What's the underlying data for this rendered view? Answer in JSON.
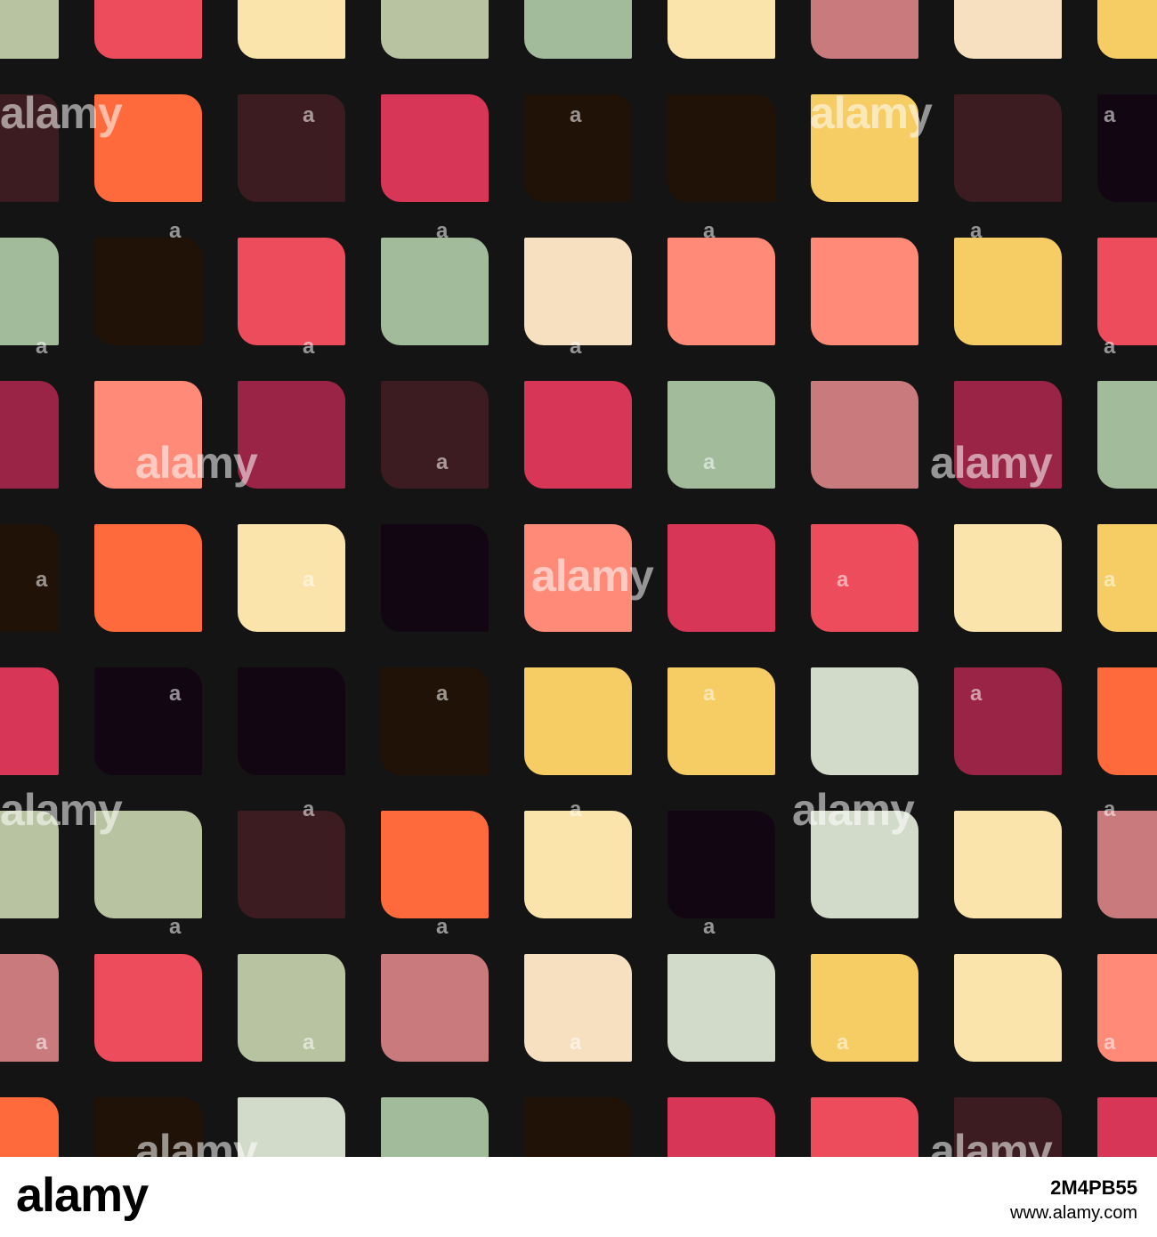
{
  "colors": {
    "background": "#141414",
    "palette": {
      "S": "#b8c3a1",
      "R": "#ec4c5c",
      "Y": "#fbe4ac",
      "M": "#a1bb9b",
      "L": "#d2dbc9",
      "P": "#c87a7c",
      "B": "#f6e0bf",
      "G": "#f6cd65",
      "O": "#ff6a3c",
      "C": "#d83656",
      "D": "#3c1c20",
      "K": "#211208",
      "N": "#120612",
      "Q": "#ff8a78",
      "W": "#9a2445"
    }
  },
  "grid": [
    [
      "S",
      "R",
      "Y",
      "S",
      "M",
      "Y",
      "P",
      "B",
      "G"
    ],
    [
      "D",
      "O",
      "D",
      "C",
      "K",
      "K",
      "G",
      "D",
      "N"
    ],
    [
      "M",
      "K",
      "R",
      "M",
      "B",
      "Q",
      "Q",
      "G",
      "R"
    ],
    [
      "W",
      "Q",
      "W",
      "D",
      "C",
      "M",
      "P",
      "W",
      "M"
    ],
    [
      "K",
      "O",
      "Y",
      "N",
      "Q",
      "C",
      "R",
      "Y",
      "G"
    ],
    [
      "C",
      "N",
      "N",
      "K",
      "G",
      "G",
      "L",
      "W",
      "O"
    ],
    [
      "S",
      "S",
      "D",
      "O",
      "Y",
      "N",
      "L",
      "Y",
      "P"
    ],
    [
      "P",
      "R",
      "S",
      "P",
      "B",
      "L",
      "G",
      "Y",
      "Q"
    ],
    [
      "O",
      "K",
      "L",
      "M",
      "K",
      "C",
      "R",
      "D",
      "C"
    ]
  ],
  "watermark": {
    "text": "alamy",
    "small_text": "a"
  },
  "footer": {
    "logo": "alamy",
    "image_id": "2M4PB55",
    "url": "www.alamy.com"
  }
}
